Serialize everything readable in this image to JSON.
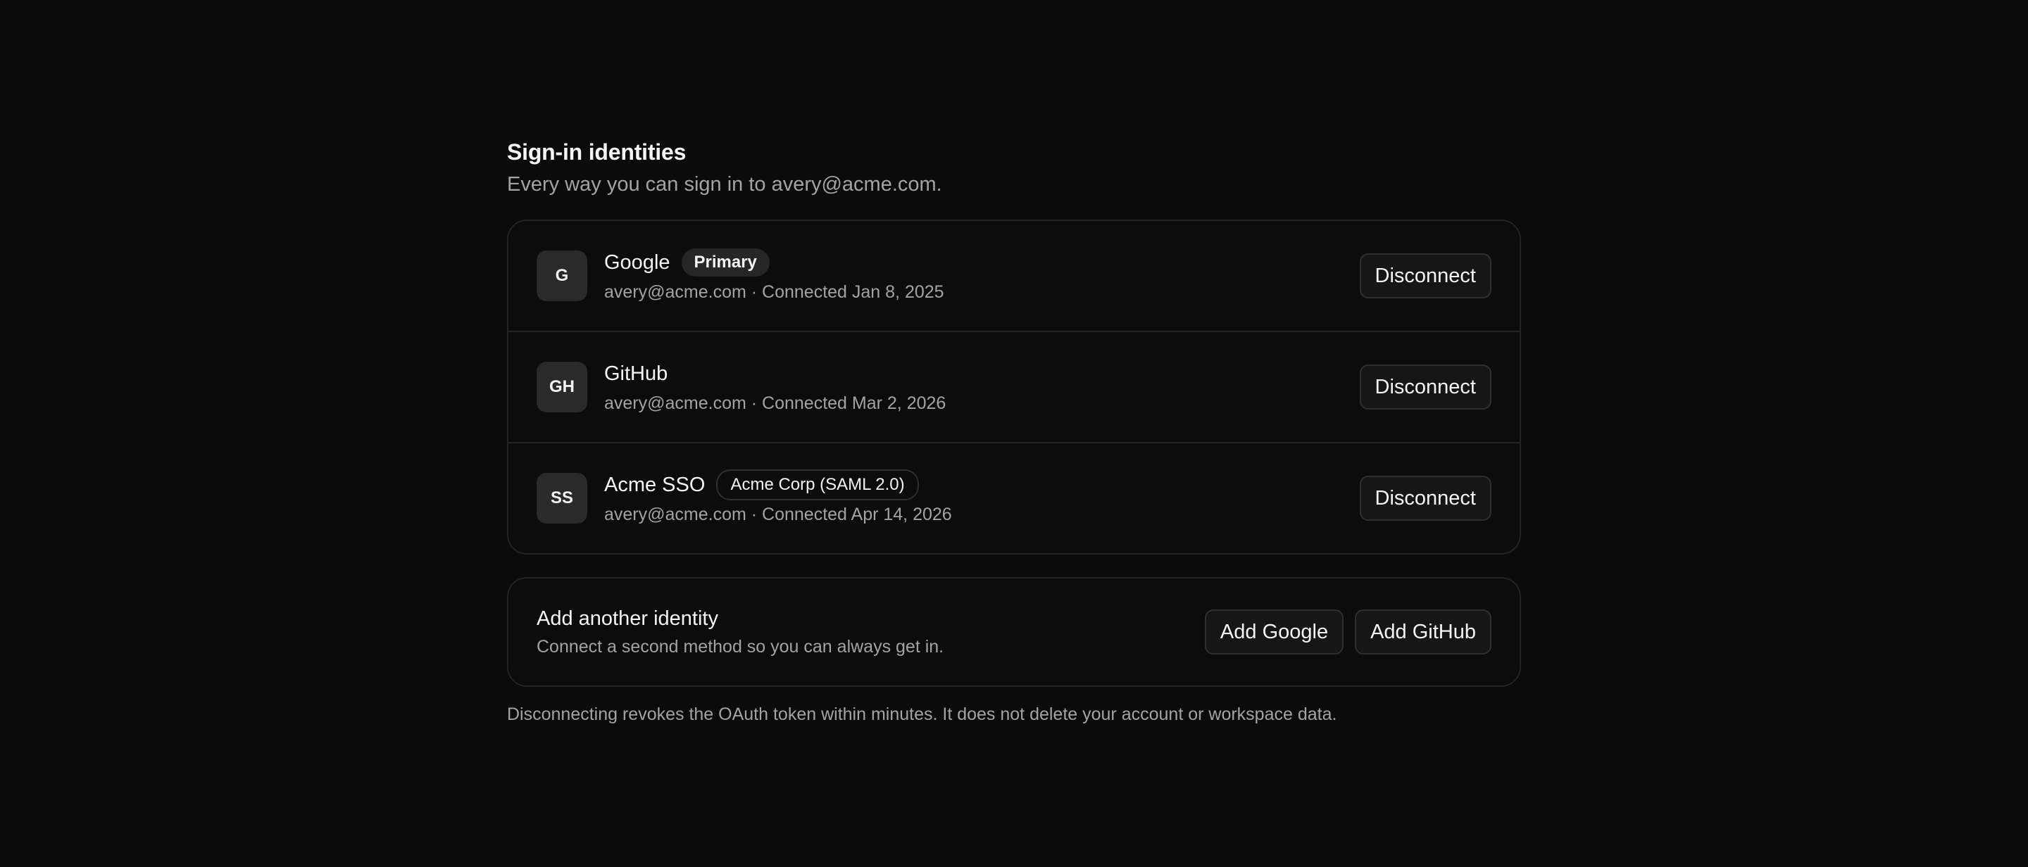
{
  "header": {
    "title": "Sign-in identities",
    "subtitle": "Every way you can sign in to avery@acme.com."
  },
  "identities": [
    {
      "initials": "G",
      "name": "Google",
      "badge": "Primary",
      "meta": "avery@acme.com · Connected Jan 8, 2025",
      "action": "Disconnect"
    },
    {
      "initials": "GH",
      "name": "GitHub",
      "badge": "",
      "meta": "avery@acme.com · Connected Mar 2, 2026",
      "action": "Disconnect"
    },
    {
      "initials": "SS",
      "name": "Acme SSO",
      "badge": "Acme Corp (SAML 2.0)",
      "meta": "avery@acme.com · Connected Apr 14, 2026",
      "action": "Disconnect"
    }
  ],
  "add_identity": {
    "title": "Add another identity",
    "subtitle": "Connect a second method so you can always get in.",
    "add_google_label": "Add Google",
    "add_github_label": "Add GitHub"
  },
  "footnote": "Disconnecting revokes the OAuth token within minutes. It does not delete your account or workspace data.",
  "colors": {
    "background": "#0b0b0b",
    "text_primary": "#f5f5f5",
    "text_secondary": "#a3a3a3",
    "border": "#232323"
  }
}
